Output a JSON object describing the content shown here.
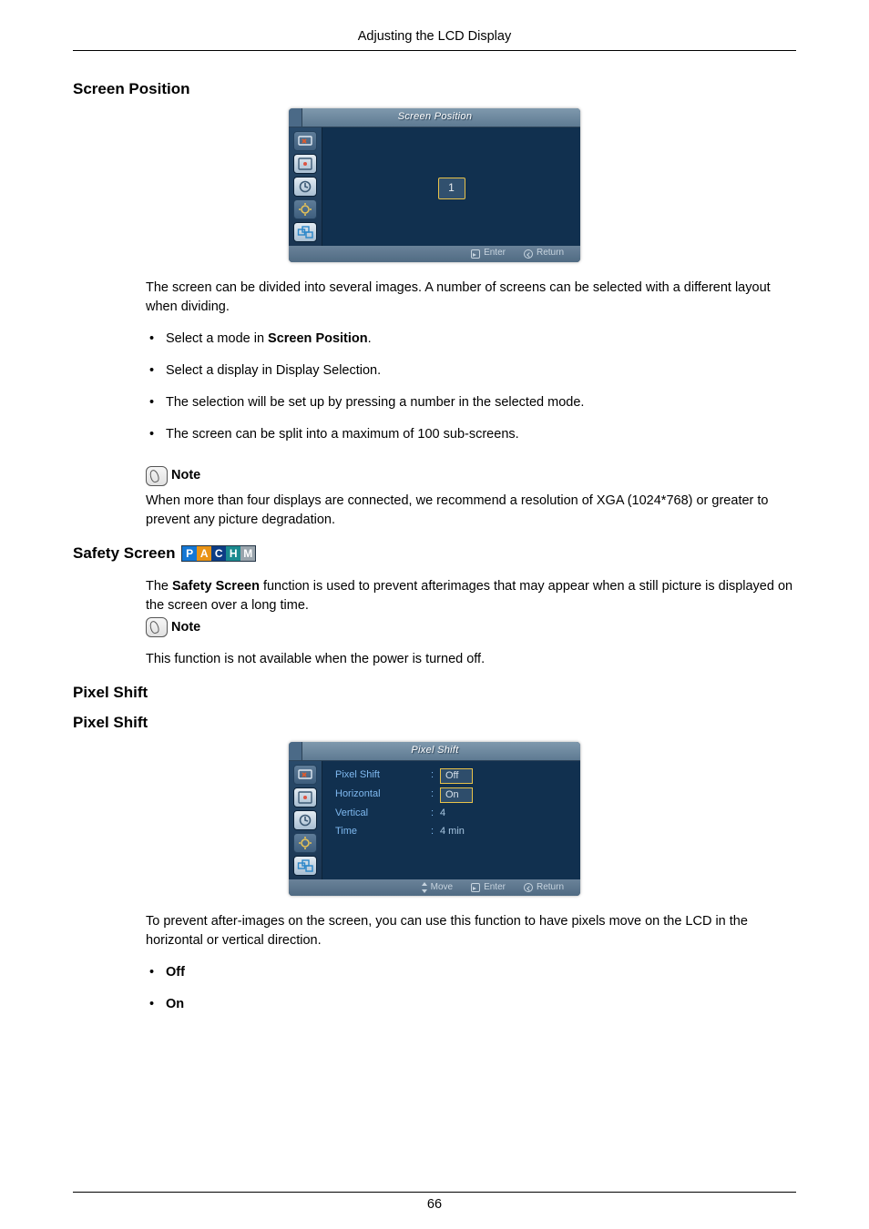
{
  "header": {
    "title": "Adjusting the LCD Display"
  },
  "screen_position": {
    "heading": "Screen Position",
    "osd": {
      "title": "Screen Position",
      "number": "1",
      "footer": {
        "enter": "Enter",
        "return": "Return"
      }
    },
    "intro": "The screen can be divided into several images. A number of screens can be selected with a different layout when dividing.",
    "bullets": [
      {
        "pre": "Select a mode in ",
        "bold": "Screen Position",
        "post": "."
      },
      {
        "text": "Select a display in Display Selection."
      },
      {
        "text": "The selection will be set up by pressing a number in the selected mode."
      },
      {
        "text": "The screen can be split into a maximum of 100 sub-screens."
      }
    ],
    "note_label": "Note",
    "note_text": "When more than four displays are connected, we recommend a resolution of XGA (1024*768) or greater to prevent any picture degradation."
  },
  "safety_screen": {
    "heading": "Safety Screen",
    "pac": [
      "P",
      "A",
      "C",
      "H",
      "M"
    ],
    "para_pre": "The ",
    "para_bold": "Safety Screen",
    "para_post": " function is used to prevent afterimages that may appear when a still picture is displayed on the screen over a long time.",
    "note_label": "Note",
    "note_text": "This function is not available when the power is turned off."
  },
  "pixel_shift": {
    "heading1": "Pixel Shift",
    "heading2": "Pixel Shift",
    "osd": {
      "title": "Pixel Shift",
      "rows": [
        {
          "label": "Pixel Shift",
          "value": "Off",
          "boxed": true
        },
        {
          "label": "Horizontal",
          "value": "On",
          "boxed": true
        },
        {
          "label": "Vertical",
          "value": "4",
          "boxed": false
        },
        {
          "label": "Time",
          "value": "4 min",
          "boxed": false
        }
      ],
      "footer": {
        "move": "Move",
        "enter": "Enter",
        "return": "Return"
      }
    },
    "para": "To prevent after-images on the screen, you can use this function to have pixels move on the LCD in the horizontal or vertical direction.",
    "options": [
      "Off",
      "On"
    ]
  },
  "page_footer": {
    "page": "66"
  }
}
